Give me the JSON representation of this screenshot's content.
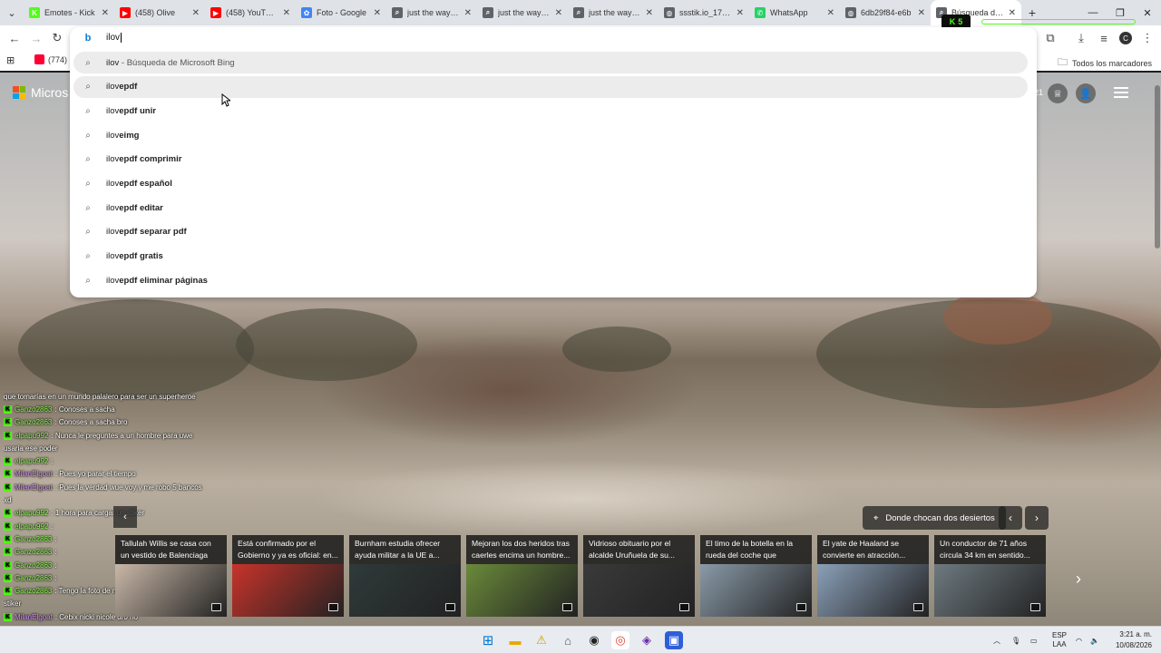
{
  "browser": {
    "tabs": [
      {
        "label": "Emotes - Kick",
        "icon_color": "#53fc18",
        "icon": "kick-icon",
        "icon_glyph": "K"
      },
      {
        "label": "(458) Olive",
        "icon_color": "#ff0000",
        "icon": "youtube-icon",
        "icon_glyph": "▶"
      },
      {
        "label": "(458) YouTube",
        "icon_color": "#ff0000",
        "icon": "youtube-icon",
        "icon_glyph": "▶"
      },
      {
        "label": "Foto - Google",
        "icon_color": "#4285f4",
        "icon": "google-photos-icon",
        "icon_glyph": "✿"
      },
      {
        "label": "just the way yo",
        "icon_color": "#5f6368",
        "icon": "search-icon",
        "icon_glyph": "⌕"
      },
      {
        "label": "just the way yo",
        "icon_color": "#5f6368",
        "icon": "search-icon",
        "icon_glyph": "⌕"
      },
      {
        "label": "just the way yo",
        "icon_color": "#5f6368",
        "icon": "search-icon",
        "icon_glyph": "⌕"
      },
      {
        "label": "ssstik.io_17863",
        "icon_color": "#5f6368",
        "icon": "globe-icon",
        "icon_glyph": "◍"
      },
      {
        "label": "WhatsApp",
        "icon_color": "#25d366",
        "icon": "whatsapp-icon",
        "icon_glyph": "✆"
      },
      {
        "label": "6db29f84-e6b",
        "icon_color": "#5f6368",
        "icon": "globe-icon",
        "icon_glyph": "◍"
      },
      {
        "label": "Búsqueda de Mi",
        "icon_color": "#5f6368",
        "icon": "search-icon",
        "icon_glyph": "⌕"
      }
    ],
    "kick_badge": "5",
    "omnibox": {
      "value": "ilov",
      "suggestions": [
        {
          "prefix": "ilov",
          "bold": "",
          "suffix": " - Búsqueda de Microsoft Bing"
        },
        {
          "prefix": "ilov",
          "bold": "epdf",
          "suffix": ""
        },
        {
          "prefix": "ilov",
          "bold": "epdf unir",
          "suffix": ""
        },
        {
          "prefix": "ilov",
          "bold": "eimg",
          "suffix": ""
        },
        {
          "prefix": "ilov",
          "bold": "epdf comprimir",
          "suffix": ""
        },
        {
          "prefix": "ilov",
          "bold": "epdf español",
          "suffix": ""
        },
        {
          "prefix": "ilov",
          "bold": "epdf editar",
          "suffix": ""
        },
        {
          "prefix": "ilov",
          "bold": "epdf separar pdf",
          "suffix": ""
        },
        {
          "prefix": "ilov",
          "bold": "epdf gratis",
          "suffix": ""
        },
        {
          "prefix": "ilov",
          "bold": "epdf eliminar páginas",
          "suffix": ""
        }
      ]
    },
    "bookmarks": {
      "item": "(774)",
      "all_label": "Todos los marcadores"
    },
    "avatar_letter": "C"
  },
  "page": {
    "logo_text": "Micros",
    "header_number": "21",
    "location_label": "Donde chocan dos desiertos",
    "chat": [
      {
        "user": "",
        "msg": "que tomarías en un mundo palalero para ser un superheroe",
        "pink": false,
        "badge": false
      },
      {
        "user": "Ganzo2863",
        "msg": ": Conoses a sacha",
        "pink": false,
        "badge": true
      },
      {
        "user": "Ganzo2863",
        "msg": ": Conoses a sacha bro",
        "pink": false,
        "badge": true
      },
      {
        "user": "elpapu992",
        "msg": ": Nunca le preguntes a un hombre para uwe",
        "pink": false,
        "badge": true
      },
      {
        "user": "",
        "msg": "usaria ese poder",
        "pink": false,
        "badge": false
      },
      {
        "user": "elpapu992",
        "msg": ":",
        "pink": false,
        "badge": true
      },
      {
        "user": "MilanElgoat",
        "msg": ": Pues yo parar el tiempo",
        "pink": true,
        "badge": true
      },
      {
        "user": "MilanElgoat",
        "msg": ": Pues la verdad wue voy y me robo 5 bancos",
        "pink": true,
        "badge": true
      },
      {
        "user": "",
        "msg": "xd",
        "pink": false,
        "badge": false
      },
      {
        "user": "elpapu992",
        "msg": ": 1 hora para cargar un stiker",
        "pink": false,
        "badge": true
      },
      {
        "user": "elpapu992",
        "msg": ":",
        "pink": false,
        "badge": true
      },
      {
        "user": "Ganzo2863",
        "msg": ":",
        "pink": false,
        "badge": true
      },
      {
        "user": "Ganzo2863",
        "msg": ":",
        "pink": false,
        "badge": true
      },
      {
        "user": "Ganzo2863",
        "msg": ":",
        "pink": false,
        "badge": true
      },
      {
        "user": "Ganzo2863",
        "msg": ":",
        "pink": false,
        "badge": true
      },
      {
        "user": "Ganzo2863",
        "msg": ": Tengo la foto de mi primo ponelo como",
        "pink": false,
        "badge": true
      },
      {
        "user": "",
        "msg": "stiker",
        "pink": false,
        "badge": false
      },
      {
        "user": "MilanElgoat",
        "msg": ": Cebix nicki nicole dr0 no",
        "pink": true,
        "badge": true
      }
    ],
    "news": [
      {
        "title": "Tallulah Willis se casa con un vestido de Balenciaga de...",
        "img": "#c9b8a8"
      },
      {
        "title": "Está confirmado por el Gobierno y ya es oficial: en...",
        "img": "#c8332a"
      },
      {
        "title": "Burnham estudia ofrecer ayuda militar a la UE a...",
        "img": "#2f3a3a"
      },
      {
        "title": "Mejoran los dos heridos tras caerles encima un hombre...",
        "img": "#6a8a3a"
      },
      {
        "title": "Vidrioso obituario por el alcalde Uruñuela de su...",
        "img": "#3a3a3a"
      },
      {
        "title": "El timo de la botella en la rueda del coche que arrasa...",
        "img": "#8a9aa8"
      },
      {
        "title": "El yate de Haaland se convierte en atracción...",
        "img": "#8aa0b8"
      },
      {
        "title": "Un conductor de 71 años circula 34 km en sentido...",
        "img": "#6e7a80"
      }
    ]
  },
  "taskbar": {
    "lang": "ESP",
    "lang_sub": "LAA",
    "time": "3:21 a. m.",
    "date": "10/08/2026"
  }
}
